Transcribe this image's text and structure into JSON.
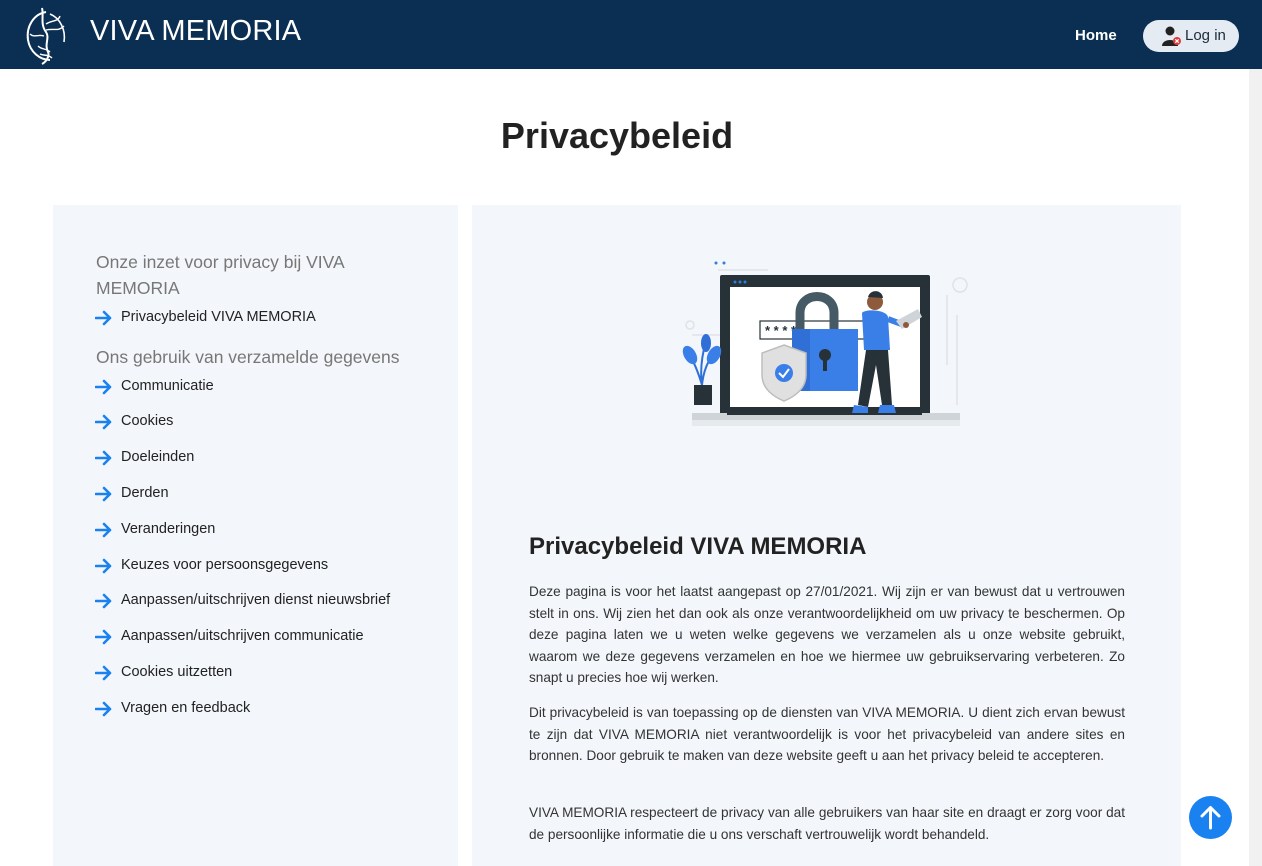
{
  "navbar": {
    "brand": "VIVA MEMORIA",
    "home_label": "Home",
    "login_label": "Log in",
    "background": "#0b2f52"
  },
  "page": {
    "title": "Privacybeleid"
  },
  "sidebar": {
    "heading_1": "Onze inzet voor privacy bij VIVA MEMORIA",
    "items_1": [
      {
        "label": "Privacybeleid VIVA MEMORIA"
      }
    ],
    "heading_2": "Ons gebruik van verzamelde gegevens",
    "items_2": [
      {
        "label": "Communicatie"
      },
      {
        "label": "Cookies"
      },
      {
        "label": "Doeleinden"
      },
      {
        "label": "Derden"
      },
      {
        "label": "Veranderingen"
      },
      {
        "label": "Keuzes voor persoonsgegevens"
      },
      {
        "label": "Aanpassen/uitschrijven dienst nieuwsbrief"
      },
      {
        "label": "Aanpassen/uitschrijven communicatie"
      },
      {
        "label": "Cookies uitzetten"
      },
      {
        "label": "Vragen en feedback"
      }
    ],
    "arrow_color": "#1a82f0"
  },
  "content": {
    "heading": "Privacybeleid VIVA MEMORIA",
    "paragraphs": [
      "Deze pagina is voor het laatst aangepast op 27/01/2021. Wij zijn er van bewust dat u vertrouwen stelt in ons. Wij zien het dan ook als onze verantwoordelijkheid om uw privacy te beschermen. Op deze pagina laten we u weten welke gegevens we verzamelen als u onze website gebruikt, waarom we deze gegevens verzamelen en hoe we hiermee uw gebruikservaring verbeteren. Zo snapt u precies hoe wij werken.",
      "Dit privacybeleid is van toepassing op de diensten van VIVA MEMORIA. U dient zich ervan bewust te zijn dat VIVA MEMORIA niet verantwoordelijk is voor het privacybeleid van andere sites en bronnen. Door gebruik te maken van deze website geeft u aan het privacy beleid te accepteren.",
      "VIVA MEMORIA respecteert de privacy van alle gebruikers van haar site en draagt er zorg voor dat de persoonlijke informatie die u ons verschaft vertrouwelijk wordt behandeld."
    ],
    "illustration_password_mask": "* * * *"
  },
  "icons": {
    "logo": "phoenix-logo-icon",
    "login": "user-icon",
    "scroll_top": "arrow-up-icon",
    "sidebar_arrow": "arrow-right-icon"
  }
}
